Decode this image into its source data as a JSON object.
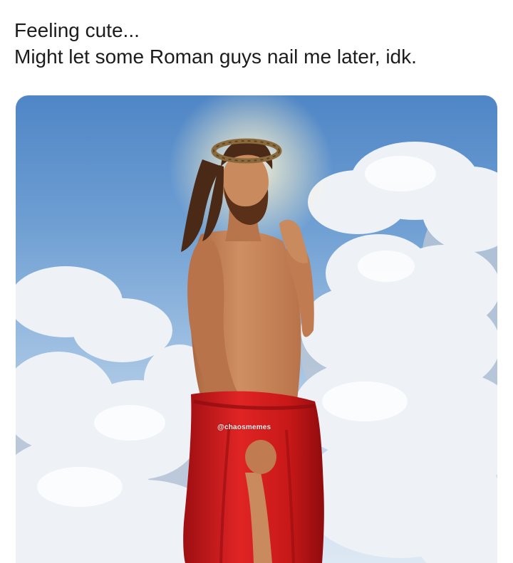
{
  "caption": {
    "line1": "Feeling cute...",
    "line2": "Might let some Roman guys nail me later, idk."
  },
  "photo": {
    "watermark": "@chaosmemes",
    "colors": {
      "sky_top": "#4f86c6",
      "sky_bottom": "#dde8f3",
      "cloud": "#eef2f7",
      "cloud_shadow": "#b9c6d6",
      "halo": "#fff7d8",
      "skin": "#c9875a",
      "skin_shadow": "#a9663f",
      "hair": "#4a2a17",
      "crown": "#8a6a3c",
      "cloth": "#d81f1f",
      "cloth_shadow": "#9e0f12"
    }
  }
}
